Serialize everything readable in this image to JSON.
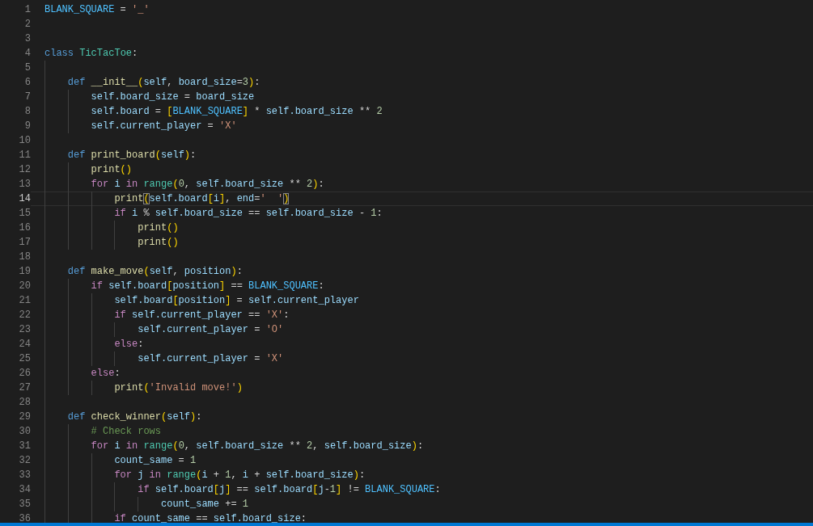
{
  "editor": {
    "lines": [
      {
        "number": "1",
        "current": false,
        "tokens": [
          {
            "text": "BLANK_SQUARE",
            "kind": "const"
          },
          {
            "text": " = ",
            "kind": "op"
          },
          {
            "text": "'_'",
            "kind": "str"
          }
        ]
      },
      {
        "number": "2",
        "current": false
      },
      {
        "number": "3",
        "current": false
      },
      {
        "number": "4",
        "current": false,
        "tokens": [
          {
            "text": "class ",
            "kind": "kw"
          },
          {
            "text": "TicTacToe",
            "kind": "cls"
          },
          {
            "text": ":",
            "kind": "op"
          }
        ],
        "children": [
          {
            "number": "5",
            "current": false
          },
          {
            "number": "6",
            "current": false,
            "tokens": [
              {
                "text": "def ",
                "kind": "kw"
              },
              {
                "text": "__init__",
                "kind": "fn"
              },
              {
                "text": "(",
                "kind": "br"
              },
              {
                "text": "self",
                "kind": "var"
              },
              {
                "text": ", ",
                "kind": "op"
              },
              {
                "text": "board_size",
                "kind": "var"
              },
              {
                "text": "=",
                "kind": "op"
              },
              {
                "text": "3",
                "kind": "num"
              },
              {
                "text": ")",
                "kind": "br"
              },
              {
                "text": ":",
                "kind": "op"
              }
            ],
            "children": [
              {
                "number": "7",
                "current": false,
                "tokens": [
                  {
                    "text": "self.board_size",
                    "kind": "var"
                  },
                  {
                    "text": " = ",
                    "kind": "op"
                  },
                  {
                    "text": "board_size",
                    "kind": "var"
                  }
                ]
              },
              {
                "number": "8",
                "current": false,
                "tokens": [
                  {
                    "text": "self.board",
                    "kind": "var"
                  },
                  {
                    "text": " = ",
                    "kind": "op"
                  },
                  {
                    "text": "[",
                    "kind": "br"
                  },
                  {
                    "text": "BLANK_SQUARE",
                    "kind": "const"
                  },
                  {
                    "text": "]",
                    "kind": "br"
                  },
                  {
                    "text": " * ",
                    "kind": "op"
                  },
                  {
                    "text": "self.board_size",
                    "kind": "var"
                  },
                  {
                    "text": " ** ",
                    "kind": "op"
                  },
                  {
                    "text": "2",
                    "kind": "num"
                  }
                ]
              },
              {
                "number": "9",
                "current": false,
                "tokens": [
                  {
                    "text": "self.current_player",
                    "kind": "var"
                  },
                  {
                    "text": " = ",
                    "kind": "op"
                  },
                  {
                    "text": "'X'",
                    "kind": "str"
                  }
                ]
              }
            ]
          },
          {
            "number": "10",
            "current": false
          },
          {
            "number": "11",
            "current": false,
            "tokens": [
              {
                "text": "def ",
                "kind": "kw"
              },
              {
                "text": "print_board",
                "kind": "fn"
              },
              {
                "text": "(",
                "kind": "br"
              },
              {
                "text": "self",
                "kind": "var"
              },
              {
                "text": ")",
                "kind": "br"
              },
              {
                "text": ":",
                "kind": "op"
              }
            ],
            "children": [
              {
                "number": "12",
                "current": false,
                "tokens": [
                  {
                    "text": "print",
                    "kind": "fn"
                  },
                  {
                    "text": "()",
                    "kind": "br"
                  }
                ]
              },
              {
                "number": "13",
                "current": false,
                "tokens": [
                  {
                    "text": "for ",
                    "kind": "ctrl"
                  },
                  {
                    "text": "i ",
                    "kind": "var"
                  },
                  {
                    "text": "in ",
                    "kind": "ctrl"
                  },
                  {
                    "text": "range",
                    "kind": "cls"
                  },
                  {
                    "text": "(",
                    "kind": "br"
                  },
                  {
                    "text": "0",
                    "kind": "num"
                  },
                  {
                    "text": ", ",
                    "kind": "op"
                  },
                  {
                    "text": "self.board_size",
                    "kind": "var"
                  },
                  {
                    "text": " ** ",
                    "kind": "op"
                  },
                  {
                    "text": "2",
                    "kind": "num"
                  },
                  {
                    "text": ")",
                    "kind": "br"
                  },
                  {
                    "text": ":",
                    "kind": "op"
                  }
                ],
                "children": [
                  {
                    "number": "14",
                    "current": true,
                    "tokens": [
                      {
                        "text": "print",
                        "kind": "fn"
                      },
                      {
                        "text": "(",
                        "kind": "brm"
                      },
                      {
                        "text": "self.board",
                        "kind": "var"
                      },
                      {
                        "text": "[",
                        "kind": "br"
                      },
                      {
                        "text": "i",
                        "kind": "var"
                      },
                      {
                        "text": "]",
                        "kind": "br"
                      },
                      {
                        "text": ", ",
                        "kind": "op"
                      },
                      {
                        "text": "end",
                        "kind": "var"
                      },
                      {
                        "text": "=",
                        "kind": "op"
                      },
                      {
                        "text": "'  '",
                        "kind": "str"
                      },
                      {
                        "text": ")",
                        "kind": "brm"
                      }
                    ]
                  },
                  {
                    "number": "15",
                    "current": false,
                    "tokens": [
                      {
                        "text": "if ",
                        "kind": "ctrl"
                      },
                      {
                        "text": "i",
                        "kind": "var"
                      },
                      {
                        "text": " % ",
                        "kind": "op"
                      },
                      {
                        "text": "self.board_size",
                        "kind": "var"
                      },
                      {
                        "text": " == ",
                        "kind": "op"
                      },
                      {
                        "text": "self.board_size",
                        "kind": "var"
                      },
                      {
                        "text": " - ",
                        "kind": "op"
                      },
                      {
                        "text": "1",
                        "kind": "num"
                      },
                      {
                        "text": ":",
                        "kind": "op"
                      }
                    ],
                    "children": [
                      {
                        "number": "16",
                        "current": false,
                        "tokens": [
                          {
                            "text": "print",
                            "kind": "fn"
                          },
                          {
                            "text": "()",
                            "kind": "br"
                          }
                        ]
                      },
                      {
                        "number": "17",
                        "current": false,
                        "tokens": [
                          {
                            "text": "print",
                            "kind": "fn"
                          },
                          {
                            "text": "()",
                            "kind": "br"
                          }
                        ]
                      }
                    ]
                  }
                ]
              }
            ]
          },
          {
            "number": "18",
            "current": false
          },
          {
            "number": "19",
            "current": false,
            "tokens": [
              {
                "text": "def ",
                "kind": "kw"
              },
              {
                "text": "make_move",
                "kind": "fn"
              },
              {
                "text": "(",
                "kind": "br"
              },
              {
                "text": "self",
                "kind": "var"
              },
              {
                "text": ", ",
                "kind": "op"
              },
              {
                "text": "position",
                "kind": "var"
              },
              {
                "text": ")",
                "kind": "br"
              },
              {
                "text": ":",
                "kind": "op"
              }
            ],
            "children": [
              {
                "number": "20",
                "current": false,
                "tokens": [
                  {
                    "text": "if ",
                    "kind": "ctrl"
                  },
                  {
                    "text": "self.board",
                    "kind": "var"
                  },
                  {
                    "text": "[",
                    "kind": "br"
                  },
                  {
                    "text": "position",
                    "kind": "var"
                  },
                  {
                    "text": "]",
                    "kind": "br"
                  },
                  {
                    "text": " == ",
                    "kind": "op"
                  },
                  {
                    "text": "BLANK_SQUARE",
                    "kind": "const"
                  },
                  {
                    "text": ":",
                    "kind": "op"
                  }
                ],
                "children": [
                  {
                    "number": "21",
                    "current": false,
                    "tokens": [
                      {
                        "text": "self.board",
                        "kind": "var"
                      },
                      {
                        "text": "[",
                        "kind": "br"
                      },
                      {
                        "text": "position",
                        "kind": "var"
                      },
                      {
                        "text": "]",
                        "kind": "br"
                      },
                      {
                        "text": " = ",
                        "kind": "op"
                      },
                      {
                        "text": "self.current_player",
                        "kind": "var"
                      }
                    ]
                  },
                  {
                    "number": "22",
                    "current": false,
                    "tokens": [
                      {
                        "text": "if ",
                        "kind": "ctrl"
                      },
                      {
                        "text": "self.current_player",
                        "kind": "var"
                      },
                      {
                        "text": " == ",
                        "kind": "op"
                      },
                      {
                        "text": "'X'",
                        "kind": "str"
                      },
                      {
                        "text": ":",
                        "kind": "op"
                      }
                    ],
                    "children": [
                      {
                        "number": "23",
                        "current": false,
                        "tokens": [
                          {
                            "text": "self.current_player",
                            "kind": "var"
                          },
                          {
                            "text": " = ",
                            "kind": "op"
                          },
                          {
                            "text": "'O'",
                            "kind": "str"
                          }
                        ]
                      }
                    ]
                  },
                  {
                    "number": "24",
                    "current": false,
                    "tokens": [
                      {
                        "text": "else",
                        "kind": "ctrl"
                      },
                      {
                        "text": ":",
                        "kind": "op"
                      }
                    ],
                    "children": [
                      {
                        "number": "25",
                        "current": false,
                        "tokens": [
                          {
                            "text": "self.current_player",
                            "kind": "var"
                          },
                          {
                            "text": " = ",
                            "kind": "op"
                          },
                          {
                            "text": "'X'",
                            "kind": "str"
                          }
                        ]
                      }
                    ]
                  }
                ]
              },
              {
                "number": "26",
                "current": false,
                "tokens": [
                  {
                    "text": "else",
                    "kind": "ctrl"
                  },
                  {
                    "text": ":",
                    "kind": "op"
                  }
                ],
                "children": [
                  {
                    "number": "27",
                    "current": false,
                    "tokens": [
                      {
                        "text": "print",
                        "kind": "fn"
                      },
                      {
                        "text": "(",
                        "kind": "br"
                      },
                      {
                        "text": "'Invalid move!'",
                        "kind": "str"
                      },
                      {
                        "text": ")",
                        "kind": "br"
                      }
                    ]
                  }
                ]
              }
            ]
          },
          {
            "number": "28",
            "current": false
          },
          {
            "number": "29",
            "current": false,
            "tokens": [
              {
                "text": "def ",
                "kind": "kw"
              },
              {
                "text": "check_winner",
                "kind": "fn"
              },
              {
                "text": "(",
                "kind": "br"
              },
              {
                "text": "self",
                "kind": "var"
              },
              {
                "text": ")",
                "kind": "br"
              },
              {
                "text": ":",
                "kind": "op"
              }
            ],
            "children": [
              {
                "number": "30",
                "current": false,
                "tokens": [
                  {
                    "text": "# Check rows",
                    "kind": "cmt"
                  }
                ]
              },
              {
                "number": "31",
                "current": false,
                "tokens": [
                  {
                    "text": "for ",
                    "kind": "ctrl"
                  },
                  {
                    "text": "i ",
                    "kind": "var"
                  },
                  {
                    "text": "in ",
                    "kind": "ctrl"
                  },
                  {
                    "text": "range",
                    "kind": "cls"
                  },
                  {
                    "text": "(",
                    "kind": "br"
                  },
                  {
                    "text": "0",
                    "kind": "num"
                  },
                  {
                    "text": ", ",
                    "kind": "op"
                  },
                  {
                    "text": "self.board_size",
                    "kind": "var"
                  },
                  {
                    "text": " ** ",
                    "kind": "op"
                  },
                  {
                    "text": "2",
                    "kind": "num"
                  },
                  {
                    "text": ", ",
                    "kind": "op"
                  },
                  {
                    "text": "self.board_size",
                    "kind": "var"
                  },
                  {
                    "text": ")",
                    "kind": "br"
                  },
                  {
                    "text": ":",
                    "kind": "op"
                  }
                ],
                "children": [
                  {
                    "number": "32",
                    "current": false,
                    "tokens": [
                      {
                        "text": "count_same",
                        "kind": "var"
                      },
                      {
                        "text": " = ",
                        "kind": "op"
                      },
                      {
                        "text": "1",
                        "kind": "num"
                      }
                    ]
                  },
                  {
                    "number": "33",
                    "current": false,
                    "tokens": [
                      {
                        "text": "for ",
                        "kind": "ctrl"
                      },
                      {
                        "text": "j ",
                        "kind": "var"
                      },
                      {
                        "text": "in ",
                        "kind": "ctrl"
                      },
                      {
                        "text": "range",
                        "kind": "cls"
                      },
                      {
                        "text": "(",
                        "kind": "br"
                      },
                      {
                        "text": "i",
                        "kind": "var"
                      },
                      {
                        "text": " + ",
                        "kind": "op"
                      },
                      {
                        "text": "1",
                        "kind": "num"
                      },
                      {
                        "text": ", ",
                        "kind": "op"
                      },
                      {
                        "text": "i",
                        "kind": "var"
                      },
                      {
                        "text": " + ",
                        "kind": "op"
                      },
                      {
                        "text": "self.board_size",
                        "kind": "var"
                      },
                      {
                        "text": ")",
                        "kind": "br"
                      },
                      {
                        "text": ":",
                        "kind": "op"
                      }
                    ],
                    "children": [
                      {
                        "number": "34",
                        "current": false,
                        "tokens": [
                          {
                            "text": "if ",
                            "kind": "ctrl"
                          },
                          {
                            "text": "self.board",
                            "kind": "var"
                          },
                          {
                            "text": "[",
                            "kind": "br"
                          },
                          {
                            "text": "j",
                            "kind": "var"
                          },
                          {
                            "text": "]",
                            "kind": "br"
                          },
                          {
                            "text": " == ",
                            "kind": "op"
                          },
                          {
                            "text": "self.board",
                            "kind": "var"
                          },
                          {
                            "text": "[",
                            "kind": "br"
                          },
                          {
                            "text": "j",
                            "kind": "var"
                          },
                          {
                            "text": "-",
                            "kind": "op"
                          },
                          {
                            "text": "1",
                            "kind": "num"
                          },
                          {
                            "text": "]",
                            "kind": "br"
                          },
                          {
                            "text": " != ",
                            "kind": "op"
                          },
                          {
                            "text": "BLANK_SQUARE",
                            "kind": "const"
                          },
                          {
                            "text": ":",
                            "kind": "op"
                          }
                        ],
                        "children": [
                          {
                            "number": "35",
                            "current": false,
                            "tokens": [
                              {
                                "text": "count_same",
                                "kind": "var"
                              },
                              {
                                "text": " += ",
                                "kind": "op"
                              },
                              {
                                "text": "1",
                                "kind": "num"
                              }
                            ]
                          }
                        ]
                      }
                    ]
                  },
                  {
                    "number": "36",
                    "current": false,
                    "tokens": [
                      {
                        "text": "if ",
                        "kind": "ctrl"
                      },
                      {
                        "text": "count_same",
                        "kind": "var"
                      },
                      {
                        "text": " == ",
                        "kind": "op"
                      },
                      {
                        "text": "self.board_size",
                        "kind": "var"
                      },
                      {
                        "text": ":",
                        "kind": "op"
                      }
                    ]
                  }
                ]
              }
            ]
          }
        ]
      }
    ]
  }
}
